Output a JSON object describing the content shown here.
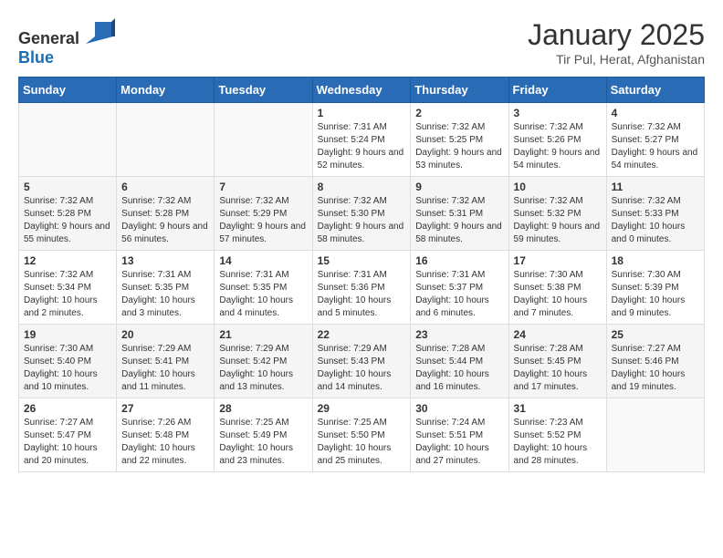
{
  "header": {
    "logo": {
      "text_general": "General",
      "text_blue": "Blue"
    },
    "title": "January 2025",
    "subtitle": "Tir Pul, Herat, Afghanistan"
  },
  "weekdays": [
    "Sunday",
    "Monday",
    "Tuesday",
    "Wednesday",
    "Thursday",
    "Friday",
    "Saturday"
  ],
  "weeks": [
    [
      {
        "day": "",
        "info": ""
      },
      {
        "day": "",
        "info": ""
      },
      {
        "day": "",
        "info": ""
      },
      {
        "day": "1",
        "info": "Sunrise: 7:31 AM\nSunset: 5:24 PM\nDaylight: 9 hours and 52 minutes."
      },
      {
        "day": "2",
        "info": "Sunrise: 7:32 AM\nSunset: 5:25 PM\nDaylight: 9 hours and 53 minutes."
      },
      {
        "day": "3",
        "info": "Sunrise: 7:32 AM\nSunset: 5:26 PM\nDaylight: 9 hours and 54 minutes."
      },
      {
        "day": "4",
        "info": "Sunrise: 7:32 AM\nSunset: 5:27 PM\nDaylight: 9 hours and 54 minutes."
      }
    ],
    [
      {
        "day": "5",
        "info": "Sunrise: 7:32 AM\nSunset: 5:28 PM\nDaylight: 9 hours and 55 minutes."
      },
      {
        "day": "6",
        "info": "Sunrise: 7:32 AM\nSunset: 5:28 PM\nDaylight: 9 hours and 56 minutes."
      },
      {
        "day": "7",
        "info": "Sunrise: 7:32 AM\nSunset: 5:29 PM\nDaylight: 9 hours and 57 minutes."
      },
      {
        "day": "8",
        "info": "Sunrise: 7:32 AM\nSunset: 5:30 PM\nDaylight: 9 hours and 58 minutes."
      },
      {
        "day": "9",
        "info": "Sunrise: 7:32 AM\nSunset: 5:31 PM\nDaylight: 9 hours and 58 minutes."
      },
      {
        "day": "10",
        "info": "Sunrise: 7:32 AM\nSunset: 5:32 PM\nDaylight: 9 hours and 59 minutes."
      },
      {
        "day": "11",
        "info": "Sunrise: 7:32 AM\nSunset: 5:33 PM\nDaylight: 10 hours and 0 minutes."
      }
    ],
    [
      {
        "day": "12",
        "info": "Sunrise: 7:32 AM\nSunset: 5:34 PM\nDaylight: 10 hours and 2 minutes."
      },
      {
        "day": "13",
        "info": "Sunrise: 7:31 AM\nSunset: 5:35 PM\nDaylight: 10 hours and 3 minutes."
      },
      {
        "day": "14",
        "info": "Sunrise: 7:31 AM\nSunset: 5:35 PM\nDaylight: 10 hours and 4 minutes."
      },
      {
        "day": "15",
        "info": "Sunrise: 7:31 AM\nSunset: 5:36 PM\nDaylight: 10 hours and 5 minutes."
      },
      {
        "day": "16",
        "info": "Sunrise: 7:31 AM\nSunset: 5:37 PM\nDaylight: 10 hours and 6 minutes."
      },
      {
        "day": "17",
        "info": "Sunrise: 7:30 AM\nSunset: 5:38 PM\nDaylight: 10 hours and 7 minutes."
      },
      {
        "day": "18",
        "info": "Sunrise: 7:30 AM\nSunset: 5:39 PM\nDaylight: 10 hours and 9 minutes."
      }
    ],
    [
      {
        "day": "19",
        "info": "Sunrise: 7:30 AM\nSunset: 5:40 PM\nDaylight: 10 hours and 10 minutes."
      },
      {
        "day": "20",
        "info": "Sunrise: 7:29 AM\nSunset: 5:41 PM\nDaylight: 10 hours and 11 minutes."
      },
      {
        "day": "21",
        "info": "Sunrise: 7:29 AM\nSunset: 5:42 PM\nDaylight: 10 hours and 13 minutes."
      },
      {
        "day": "22",
        "info": "Sunrise: 7:29 AM\nSunset: 5:43 PM\nDaylight: 10 hours and 14 minutes."
      },
      {
        "day": "23",
        "info": "Sunrise: 7:28 AM\nSunset: 5:44 PM\nDaylight: 10 hours and 16 minutes."
      },
      {
        "day": "24",
        "info": "Sunrise: 7:28 AM\nSunset: 5:45 PM\nDaylight: 10 hours and 17 minutes."
      },
      {
        "day": "25",
        "info": "Sunrise: 7:27 AM\nSunset: 5:46 PM\nDaylight: 10 hours and 19 minutes."
      }
    ],
    [
      {
        "day": "26",
        "info": "Sunrise: 7:27 AM\nSunset: 5:47 PM\nDaylight: 10 hours and 20 minutes."
      },
      {
        "day": "27",
        "info": "Sunrise: 7:26 AM\nSunset: 5:48 PM\nDaylight: 10 hours and 22 minutes."
      },
      {
        "day": "28",
        "info": "Sunrise: 7:25 AM\nSunset: 5:49 PM\nDaylight: 10 hours and 23 minutes."
      },
      {
        "day": "29",
        "info": "Sunrise: 7:25 AM\nSunset: 5:50 PM\nDaylight: 10 hours and 25 minutes."
      },
      {
        "day": "30",
        "info": "Sunrise: 7:24 AM\nSunset: 5:51 PM\nDaylight: 10 hours and 27 minutes."
      },
      {
        "day": "31",
        "info": "Sunrise: 7:23 AM\nSunset: 5:52 PM\nDaylight: 10 hours and 28 minutes."
      },
      {
        "day": "",
        "info": ""
      }
    ]
  ]
}
